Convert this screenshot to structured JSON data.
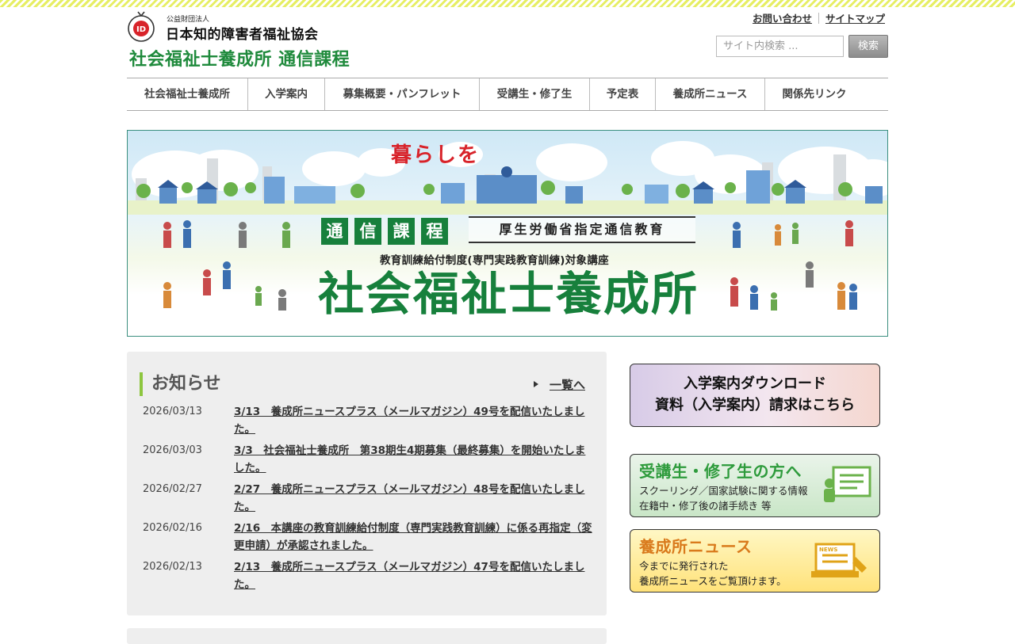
{
  "header": {
    "org_sub": "公益財団法人",
    "org_name": "日本知的障害者福祉協会",
    "site_title": "社会福祉士養成所 通信課程",
    "util_links": [
      "お問い合わせ",
      "サイトマップ"
    ],
    "search": {
      "placeholder": "サイト内検索 ...",
      "button": "検索"
    }
  },
  "nav": {
    "items": [
      "社会福祉士養成所",
      "入学案内",
      "募集概要・パンフレット",
      "受講生・修了生",
      "予定表",
      "養成所ニュース",
      "関係先リンク"
    ]
  },
  "banner": {
    "tagline": "暮らしを",
    "tags": [
      "通",
      "信",
      "課",
      "程"
    ],
    "ministry": "厚生労働省指定通信教育",
    "sub": "教育訓練給付制度(専門実践教育訓練)対象講座",
    "main": "社会福祉士養成所"
  },
  "news": {
    "heading": "お知らせ",
    "more": "一覧へ",
    "items": [
      {
        "date": "2026/03/13",
        "title": "3/13　養成所ニュースプラス（メールマガジン）49号を配信いたしました。"
      },
      {
        "date": "2026/03/03",
        "title": "3/3　社会福祉士養成所　第38期生4期募集（最終募集）を開始いたしました。"
      },
      {
        "date": "2026/02/27",
        "title": "2/27　養成所ニュースプラス（メールマガジン）48号を配信いたしました。"
      },
      {
        "date": "2026/02/16",
        "title": "2/16　本講座の教育訓練給付制度（専門実践教育訓練）に係る再指定（変更申請）が承認されました。"
      },
      {
        "date": "2026/02/13",
        "title": "2/13　養成所ニュースプラス（メールマガジン）47号を配信いたしました。"
      }
    ]
  },
  "sidebar": {
    "download": {
      "line1": "入学案内ダウンロード",
      "line2": "資料（入学案内）請求はこちら"
    },
    "students": {
      "title": "受講生・修了生の方へ",
      "desc1": "スクーリング／国家試験に関する情報",
      "desc2": "在籍中・修了後の諸手続き 等"
    },
    "news": {
      "title": "養成所ニュース",
      "desc1": "今までに発行された",
      "desc2": "養成所ニュースをご覧頂けます。",
      "icon_label": "NEWS"
    }
  },
  "colors": {
    "brand_green": "#1f8a3c",
    "accent_lime": "#8dc63f",
    "banner_green": "#17803c",
    "tagline_red": "#d8232a"
  }
}
